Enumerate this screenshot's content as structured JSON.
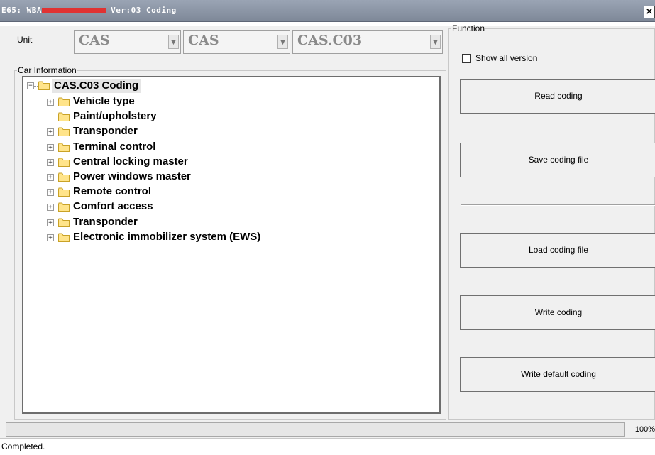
{
  "window": {
    "title_prefix": "E65: WBA",
    "title_suffix": " Ver:03 Coding",
    "close_label": "×"
  },
  "unit": {
    "label": "Unit",
    "selects": [
      "CAS",
      "CAS",
      "CAS.C03"
    ]
  },
  "car_info": {
    "legend": "Car Information",
    "root": "CAS.C03 Coding",
    "items": [
      {
        "label": "Vehicle type",
        "expandable": true
      },
      {
        "label": "Paint/upholstery",
        "expandable": false
      },
      {
        "label": "Transponder",
        "expandable": true
      },
      {
        "label": "Terminal control",
        "expandable": true
      },
      {
        "label": "Central locking master",
        "expandable": true
      },
      {
        "label": "Power windows master",
        "expandable": true
      },
      {
        "label": "Remote control",
        "expandable": true
      },
      {
        "label": "Comfort access",
        "expandable": true
      },
      {
        "label": "Transponder",
        "expandable": true
      },
      {
        "label": "Electronic immobilizer system (EWS)",
        "expandable": true
      }
    ]
  },
  "function": {
    "legend": "Function",
    "show_all_label": "Show all version",
    "buttons": {
      "read": "Read coding",
      "save": "Save coding file",
      "load": "Load coding file",
      "write": "Write coding",
      "write_default": "Write default coding"
    }
  },
  "progress": {
    "percent_label": "100%",
    "value": 1.0
  },
  "status": "Completed.",
  "colors": {
    "folder": "#ffe48a",
    "folder_border": "#c9a227",
    "redaction": "#e03232"
  }
}
